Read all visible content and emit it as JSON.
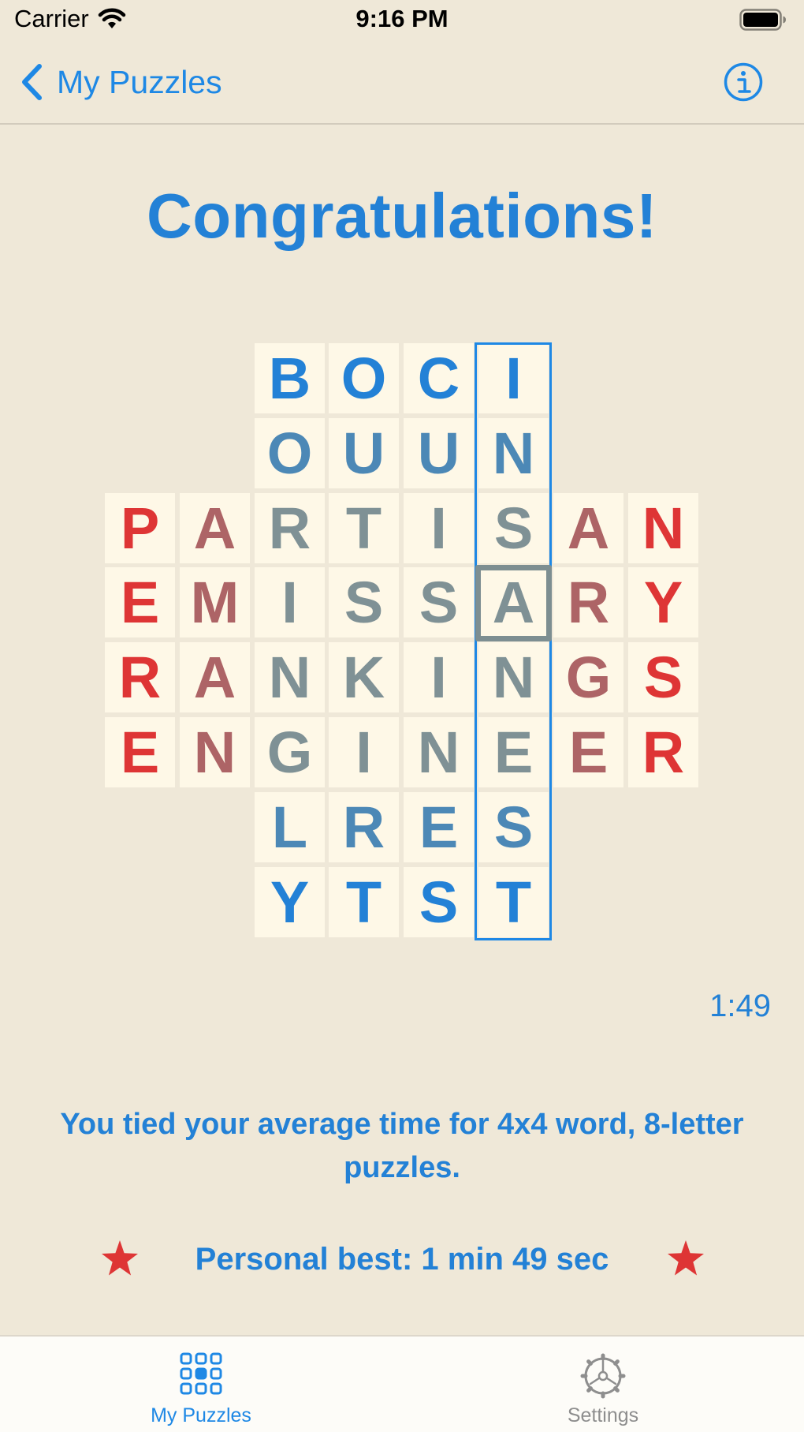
{
  "status": {
    "carrier": "Carrier",
    "time": "9:16 PM"
  },
  "nav": {
    "back_label": "My Puzzles"
  },
  "title": "Congratulations!",
  "puzzle": {
    "rows": [
      [
        null,
        null,
        "B",
        "O",
        "C",
        "I",
        null,
        null
      ],
      [
        null,
        null,
        "O",
        "U",
        "U",
        "N",
        null,
        null
      ],
      [
        "P",
        "A",
        "R",
        "T",
        "I",
        "S",
        "A",
        "N"
      ],
      [
        "E",
        "M",
        "I",
        "S",
        "S",
        "A",
        "R",
        "Y"
      ],
      [
        "R",
        "A",
        "N",
        "K",
        "I",
        "N",
        "G",
        "S"
      ],
      [
        "E",
        "N",
        "G",
        "I",
        "N",
        "E",
        "E",
        "R"
      ],
      [
        null,
        null,
        "L",
        "R",
        "E",
        "S",
        null,
        null
      ],
      [
        null,
        null,
        "Y",
        "T",
        "S",
        "T",
        null,
        null
      ]
    ],
    "highlighted_column": 5,
    "selected_cell": [
      3,
      5
    ],
    "colors": {
      "red": "#DE3535",
      "mauve": "#AD6466",
      "gray": "#7F9195",
      "steel": "#4C88B6",
      "blue": "#2381D6",
      "highlight": "#1E88E5",
      "selection": "#7D8E91"
    }
  },
  "timer": "1:49",
  "message": "You tied your average time for 4x4 word, 8-letter puzzles.",
  "personal_best": "Personal best: 1 min 49 sec",
  "tabs": [
    {
      "label": "My Puzzles",
      "icon": "grid-icon",
      "active": true
    },
    {
      "label": "Settings",
      "icon": "gear-icon",
      "active": false
    }
  ]
}
